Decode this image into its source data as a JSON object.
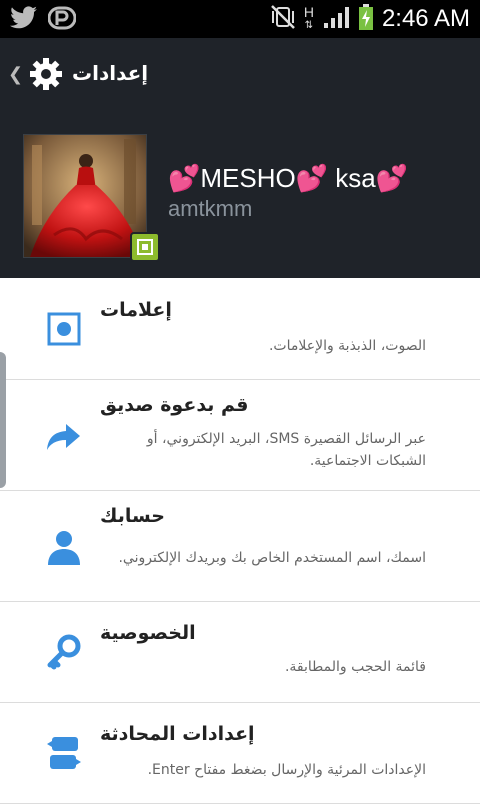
{
  "status_bar": {
    "time": "2:46 AM",
    "network": "H",
    "left_icons": [
      "twitter-bird-icon",
      "periscope-p-icon"
    ],
    "right_icons": [
      "vibrate-mute-icon",
      "hspa-network-icon",
      "signal-bars-icon",
      "battery-charging-icon"
    ]
  },
  "action_bar": {
    "title": "إعدادات",
    "back_icon": "chevron-left-icon",
    "settings_icon": "gear-icon"
  },
  "profile": {
    "display_name": "💕MESHO💕 ksa💕",
    "handle": "amtkmm",
    "avatar_alt": "profile-photo",
    "avatar_badge_icon": "badge-square-icon"
  },
  "settings": {
    "items": [
      {
        "title": "إعلامات",
        "desc": "الصوت، الذبذبة والإعلامات.",
        "icon": "notifications-icon"
      },
      {
        "title": "قم بدعوة صديق",
        "desc": "عبر الرسائل القصيرة SMS، البريد الإلكتروني، أو الشبكات الاجتماعية.",
        "icon": "share-arrow-icon"
      },
      {
        "title": "حسابك",
        "desc": "اسمك، اسم المستخدم الخاص بك وبريدك الإلكتروني.",
        "icon": "user-icon"
      },
      {
        "title": "الخصوصية",
        "desc": "قائمة الحجب والمطابقة.",
        "icon": "key-icon"
      },
      {
        "title": "إعدادات المحادثة",
        "desc": "الإعدادات المرئية والإرسال بضغط مفتاح Enter.",
        "icon": "chat-settings-icon"
      }
    ]
  },
  "colors": {
    "accent": "#3a8fde",
    "header_bg": "#1f2329",
    "status_bg": "#000000",
    "divider": "#dcdcdc",
    "badge_green": "#8dbb2d"
  }
}
